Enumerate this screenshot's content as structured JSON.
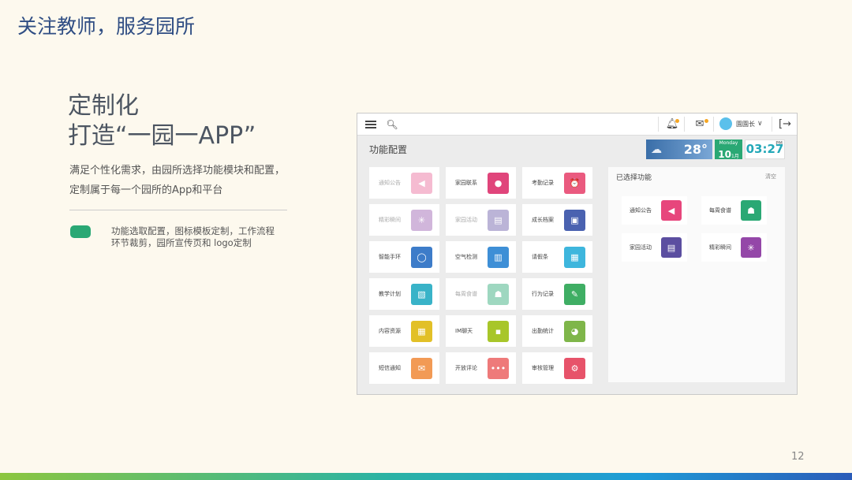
{
  "slide": {
    "title": "关注教师，服务园所",
    "heading_line1": "定制化",
    "heading_line2": "打造“一园一APP”",
    "desc_line1": "满足个性化需求，由园所选择功能模块和配置，",
    "desc_line2": "定制属于每一个园所的App和平台",
    "feature_line1": "功能选取配置，图标模板定制，工作流程",
    "feature_line2": "环节裁剪，园所宣传页和 logo定制",
    "page_number": "12",
    "accent_color": "#2aa874"
  },
  "app": {
    "user_name": "園園长",
    "panel_title": "功能配置",
    "temperature": "28°",
    "date_month": "Monday",
    "date_day": "10",
    "date_unit": "1月",
    "time": "03:27",
    "time_suffix": "PM",
    "tiles": [
      {
        "label": "通知公告",
        "icon": "megaphone-icon",
        "glyph": "◀",
        "color": "#e96a9a",
        "dim": true
      },
      {
        "label": "家园联系",
        "icon": "chat-icon",
        "glyph": "●",
        "color": "#e0457b",
        "dim": false
      },
      {
        "label": "考勤记录",
        "icon": "alarm-clock-icon",
        "glyph": "⏰",
        "color": "#ea5a7f",
        "dim": false
      },
      {
        "label": "精彩瞬间",
        "icon": "sun-icon",
        "glyph": "✳",
        "color": "#9b5fb0",
        "dim": true
      },
      {
        "label": "家园活动",
        "icon": "document-icon",
        "glyph": "▤",
        "color": "#6a5aa8",
        "dim": true
      },
      {
        "label": "成长档案",
        "icon": "chart-line-icon",
        "glyph": "▣",
        "color": "#4a62b0",
        "dim": false
      },
      {
        "label": "智能手环",
        "icon": "ring-icon",
        "glyph": "◯",
        "color": "#3d7cc9",
        "dim": false
      },
      {
        "label": "空气检测",
        "icon": "bar-chart-icon",
        "glyph": "▥",
        "color": "#3e8fd6",
        "dim": false
      },
      {
        "label": "请假条",
        "icon": "calendar-icon",
        "glyph": "▦",
        "color": "#3eb6dd",
        "dim": false
      },
      {
        "label": "教学计划",
        "icon": "presentation-icon",
        "glyph": "▧",
        "color": "#39b3c8",
        "dim": false
      },
      {
        "label": "每周食谱",
        "icon": "chef-hat-icon",
        "glyph": "☗",
        "color": "#2aa874",
        "dim": true
      },
      {
        "label": "行为记录",
        "icon": "pencil-icon",
        "glyph": "✎",
        "color": "#3fae64",
        "dim": false
      },
      {
        "label": "内容资源",
        "icon": "grid-icon",
        "glyph": "▦",
        "color": "#e2c027",
        "dim": false
      },
      {
        "label": "IM聊天",
        "icon": "message-icon",
        "glyph": "▪",
        "color": "#a8c62a",
        "dim": false
      },
      {
        "label": "出勤统计",
        "icon": "pie-chart-icon",
        "glyph": "◕",
        "color": "#7fb64a",
        "dim": false
      },
      {
        "label": "短信通知",
        "icon": "envelope-icon",
        "glyph": "✉",
        "color": "#f29a55",
        "dim": false
      },
      {
        "label": "开放评论",
        "icon": "dots-icon",
        "glyph": "•••",
        "color": "#ee7a7a",
        "dim": false
      },
      {
        "label": "审核管理",
        "icon": "gear-icon",
        "glyph": "⚙",
        "color": "#e7536a",
        "dim": false
      }
    ],
    "selected_title": "已选择功能",
    "clear_label": "清空",
    "selected": [
      {
        "label": "通知公告",
        "icon": "megaphone-icon",
        "glyph": "◀",
        "color": "#e7467c"
      },
      {
        "label": "每周食谱",
        "icon": "chef-hat-icon",
        "glyph": "☗",
        "color": "#2aa874"
      },
      {
        "label": "家园活动",
        "icon": "document-icon",
        "glyph": "▤",
        "color": "#5b4ea0"
      },
      {
        "label": "精彩瞬间",
        "icon": "sun-icon",
        "glyph": "✳",
        "color": "#9447a8"
      }
    ]
  }
}
